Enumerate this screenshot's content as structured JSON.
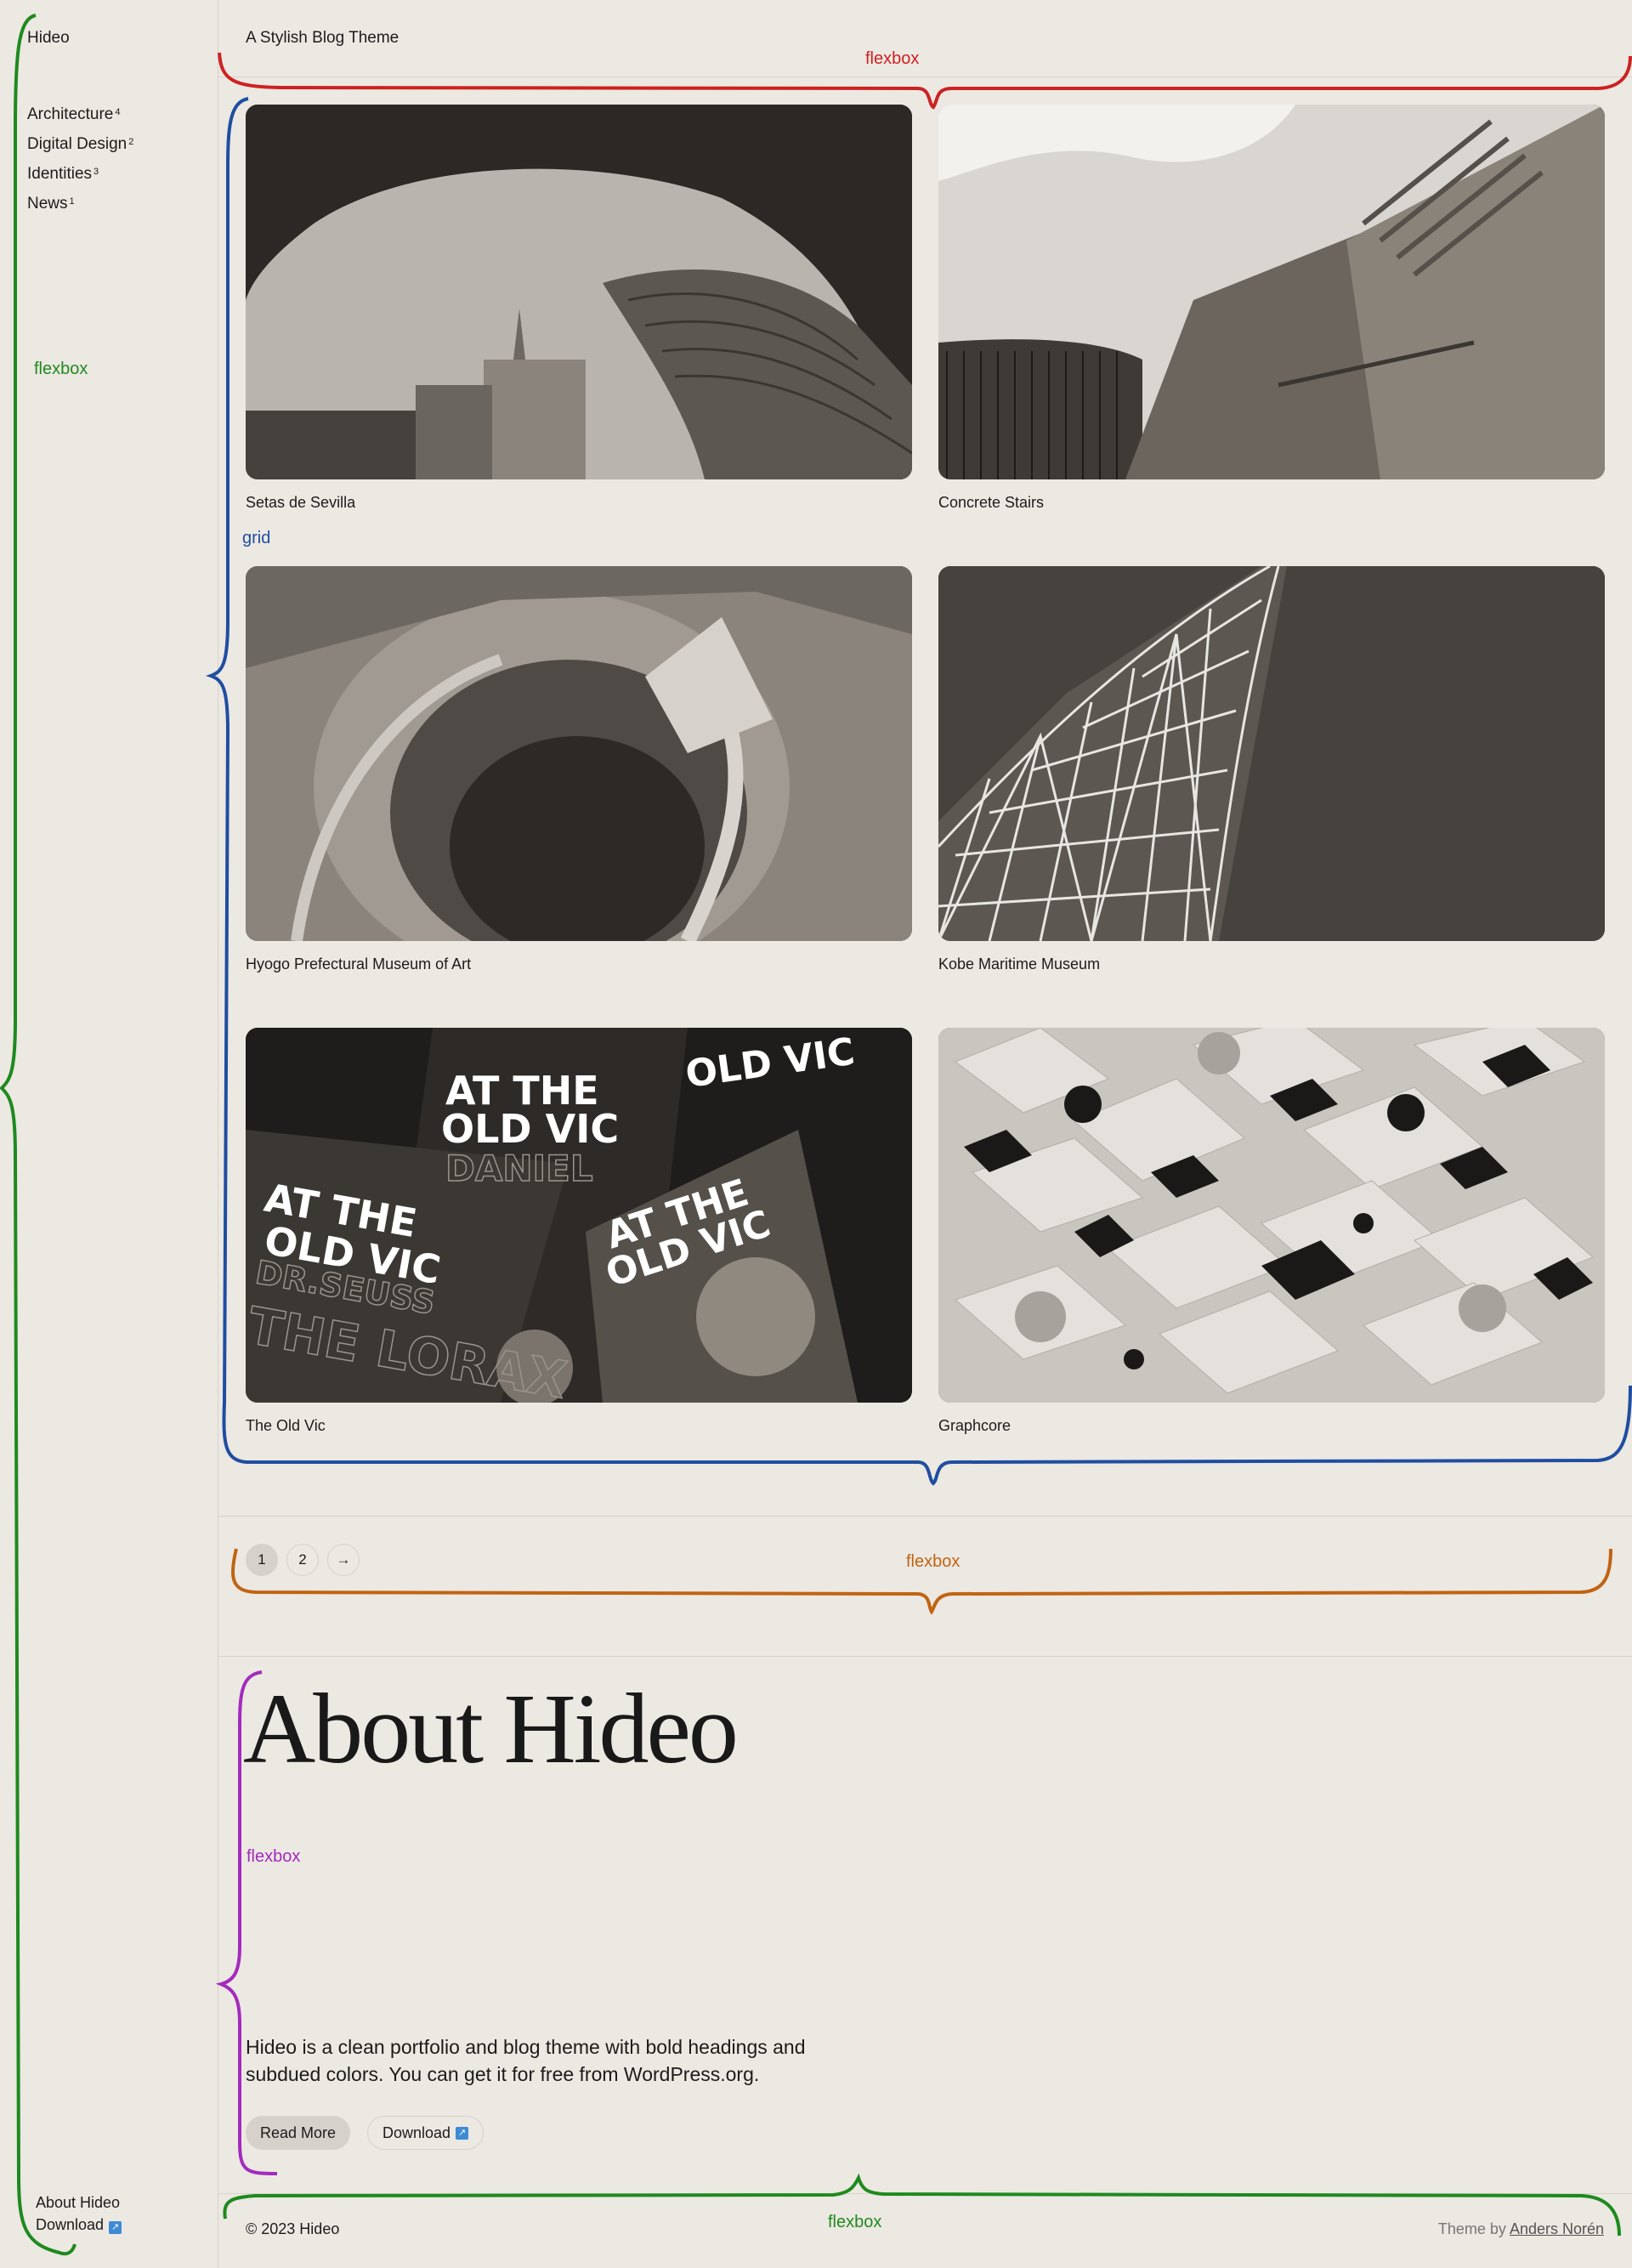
{
  "site": {
    "name": "Hideo",
    "tagline": "A Stylish Blog Theme"
  },
  "sidebar": {
    "categories": [
      {
        "label": "Architecture",
        "count": "4"
      },
      {
        "label": "Digital Design",
        "count": "2"
      },
      {
        "label": "Identities",
        "count": "3"
      },
      {
        "label": "News",
        "count": "1"
      }
    ],
    "footer_links": [
      {
        "label": "About Hideo"
      },
      {
        "label": "Download"
      }
    ]
  },
  "posts": [
    {
      "title": "Setas de Sevilla"
    },
    {
      "title": "Concrete Stairs"
    },
    {
      "title": "Hyogo Prefectural Museum of Art"
    },
    {
      "title": "Kobe Maritime Museum"
    },
    {
      "title": "The Old Vic"
    },
    {
      "title": "Graphcore"
    }
  ],
  "old_vic_poster": {
    "line1": "AT THE",
    "line2": "OLD VIC",
    "line3": "DANIEL",
    "line4": "DR.SEUSS",
    "line5": "THE LORAX"
  },
  "pagination": {
    "pages": [
      "1",
      "2"
    ],
    "next": "→"
  },
  "about": {
    "title": "About Hideo",
    "text": "Hideo is a clean portfolio and blog theme with bold headings and subdued colors. You can get it for free from WordPress.org.",
    "read_more": "Read More",
    "download": "Download"
  },
  "footer": {
    "copyright": "© 2023 Hideo",
    "credit_prefix": "Theme by",
    "credit_author": "Anders Norén"
  },
  "annotations": {
    "label": "flexbox",
    "grid_label": "grid"
  },
  "colors": {
    "background": "#ece8e2",
    "red": "#cc2222",
    "blue": "#1f4ea0",
    "green": "#1e8a1e",
    "orange": "#c06412",
    "purple": "#a22bbd"
  }
}
